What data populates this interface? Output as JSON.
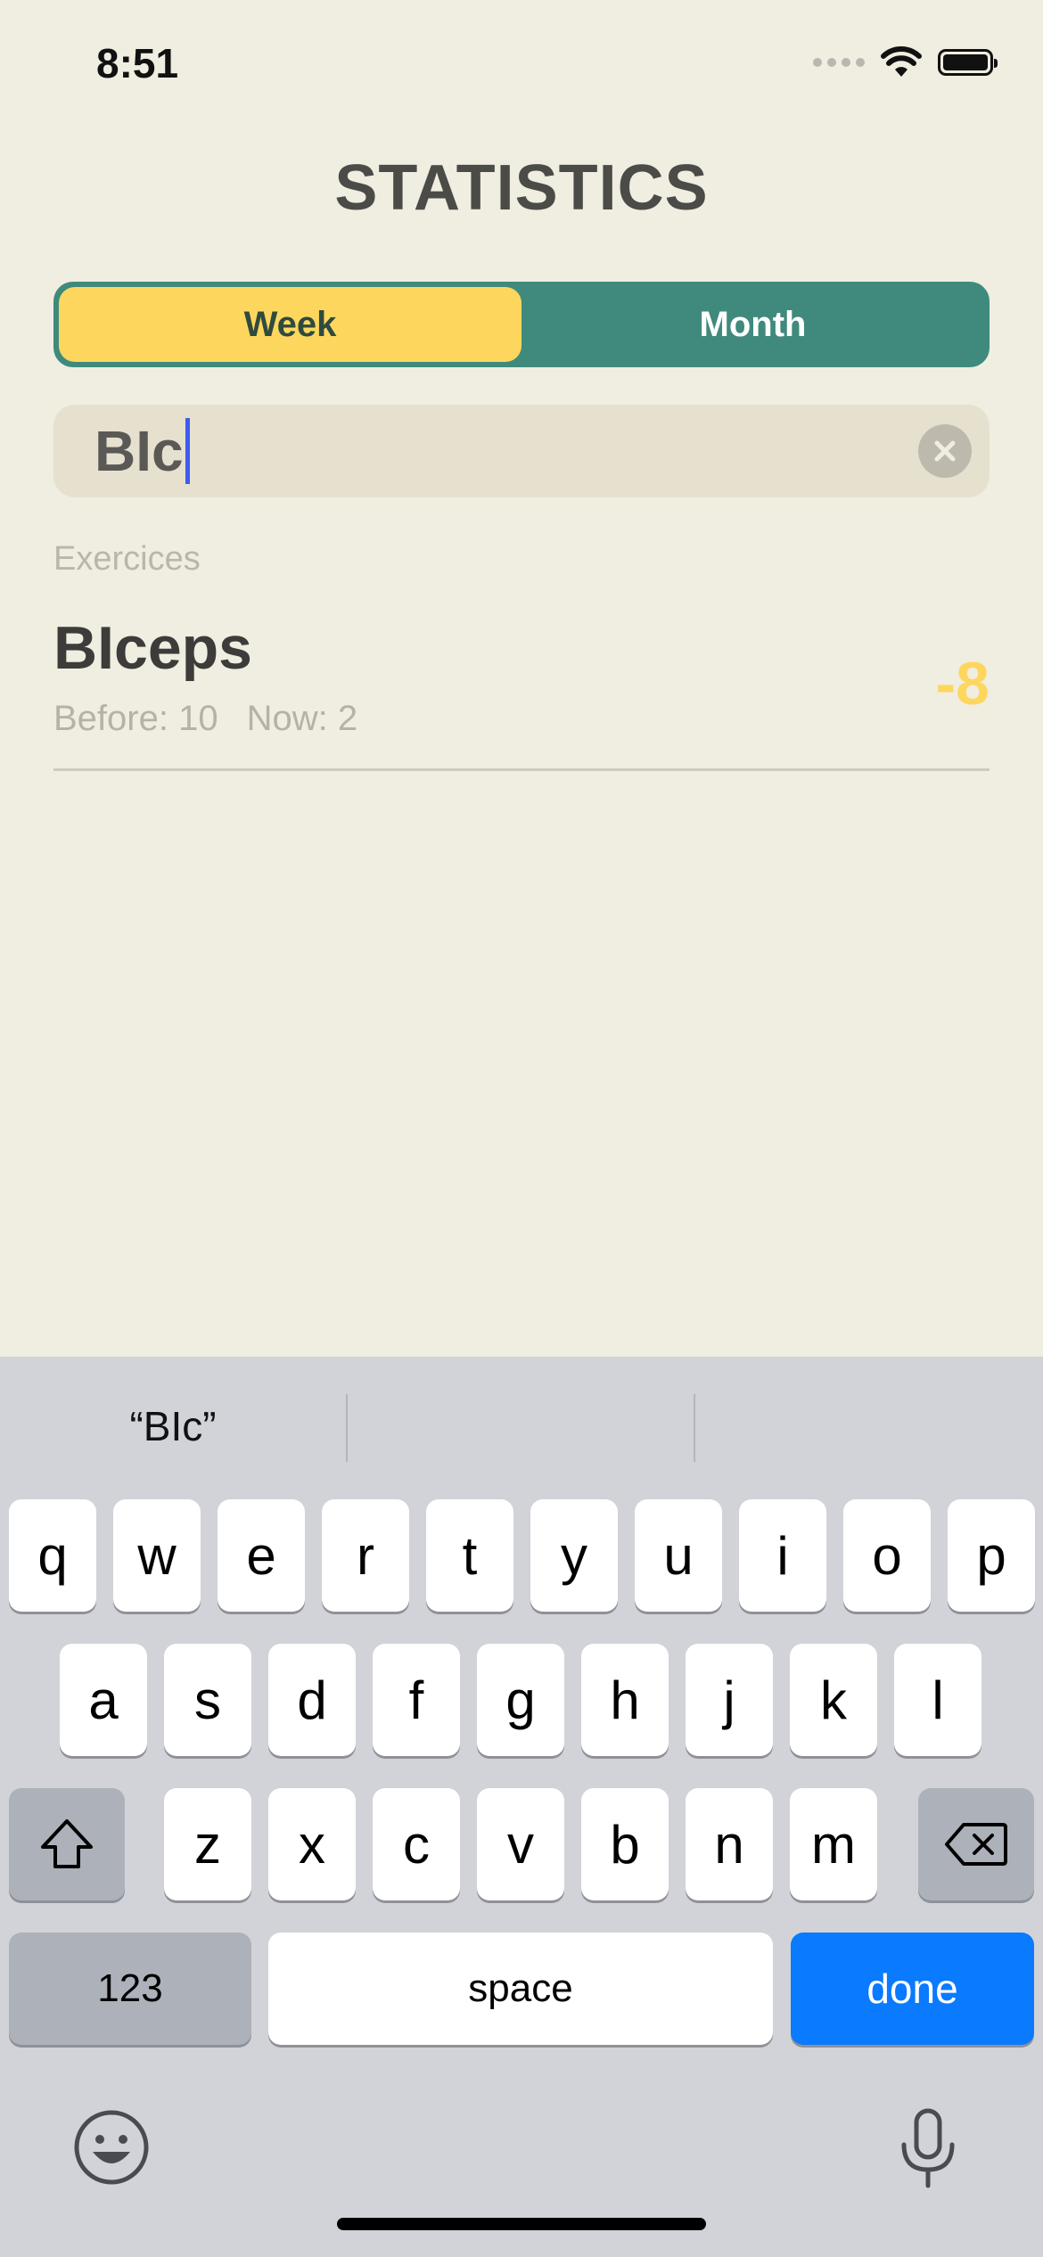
{
  "status_bar": {
    "time": "8:51"
  },
  "header": {
    "title": "STATISTICS"
  },
  "segmented": {
    "week": "Week",
    "month": "Month",
    "selected": "Week"
  },
  "search": {
    "value": "BIc"
  },
  "section": {
    "label": "Exercices"
  },
  "results": [
    {
      "name": "BIceps",
      "before": "Before: 10",
      "now": "Now: 2",
      "delta": "-8"
    }
  ],
  "keyboard": {
    "suggestion": "“BIc”",
    "row1": [
      "q",
      "w",
      "e",
      "r",
      "t",
      "y",
      "u",
      "i",
      "o",
      "p"
    ],
    "row2": [
      "a",
      "s",
      "d",
      "f",
      "g",
      "h",
      "j",
      "k",
      "l"
    ],
    "row3": [
      "z",
      "x",
      "c",
      "v",
      "b",
      "n",
      "m"
    ],
    "numbers_label": "123",
    "space_label": "space",
    "done_label": "done"
  },
  "colors": {
    "accent": "#fdd75d",
    "teal": "#3f8a7c",
    "background": "#f0ede1",
    "keyboard_blue": "#0a7aff"
  }
}
